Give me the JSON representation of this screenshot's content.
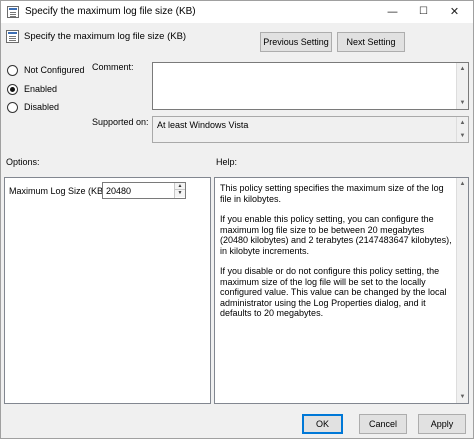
{
  "window": {
    "title": "Specify the maximum log file size (KB)",
    "minimize": "—",
    "maximize": "☐",
    "close": "✕"
  },
  "header": {
    "title": "Specify the maximum log file size (KB)",
    "previous_setting": "Previous Setting",
    "next_setting": "Next Setting"
  },
  "state": {
    "options": [
      {
        "label": "Not Configured",
        "checked": false
      },
      {
        "label": "Enabled",
        "checked": true
      },
      {
        "label": "Disabled",
        "checked": false
      }
    ]
  },
  "comment": {
    "label": "Comment:",
    "value": ""
  },
  "supported": {
    "label": "Supported on:",
    "value": "At least Windows Vista"
  },
  "options_pane": {
    "label": "Options:",
    "field_label": "Maximum Log Size (KB)",
    "field_value": "20480"
  },
  "help_pane": {
    "label": "Help:",
    "paragraphs": [
      "This policy setting specifies the maximum size of the log file in kilobytes.",
      "If you enable this policy setting, you can configure the maximum log file size to be between 20 megabytes (20480 kilobytes) and 2 terabytes (2147483647 kilobytes), in kilobyte increments.",
      "If you disable or do not configure this policy setting, the maximum size of the log file will be set to the locally configured value. This value can be changed by the local administrator using the Log Properties dialog, and it defaults to 20 megabytes."
    ]
  },
  "footer": {
    "ok": "OK",
    "cancel": "Cancel",
    "apply": "Apply"
  },
  "colors": {
    "accent": "#0078d7",
    "button_face": "#e1e1e1",
    "dialog_bg": "#f0f0f0"
  }
}
